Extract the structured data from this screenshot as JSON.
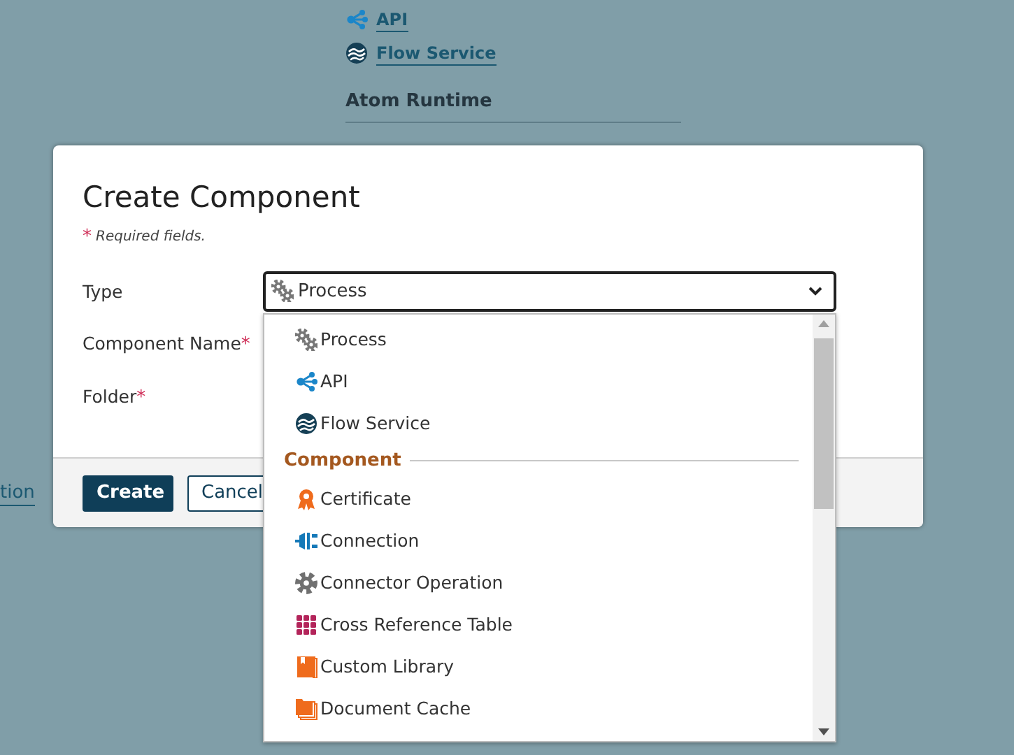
{
  "background": {
    "links": [
      {
        "label": "API"
      },
      {
        "label": "Flow Service"
      }
    ],
    "section_title": "Atom Runtime",
    "side_link": "tion"
  },
  "dialog": {
    "title": "Create Component",
    "required_mark": "*",
    "required_note": "Required fields.",
    "fields": [
      {
        "label": "Type",
        "kind": "select"
      },
      {
        "label": "Component Name",
        "mark": "*",
        "kind": "text"
      },
      {
        "label": "Folder",
        "mark": "*",
        "kind": "text"
      }
    ],
    "type_select": {
      "value": "Process",
      "expanded": true
    },
    "dropdown": [
      {
        "kind": "option",
        "label": "Process"
      },
      {
        "kind": "option",
        "label": "API"
      },
      {
        "kind": "option",
        "label": "Flow Service"
      },
      {
        "kind": "group",
        "label": "Component"
      },
      {
        "kind": "option",
        "label": "Certificate"
      },
      {
        "kind": "option",
        "label": "Connection"
      },
      {
        "kind": "option",
        "label": "Connector Operation"
      },
      {
        "kind": "option",
        "label": "Cross Reference Table"
      },
      {
        "kind": "option",
        "label": "Custom Library"
      },
      {
        "kind": "option",
        "label": "Document Cache"
      }
    ],
    "buttons": [
      {
        "label": "Create",
        "kind": "primary"
      },
      {
        "label": "Cancel",
        "kind": "secondary"
      }
    ]
  }
}
